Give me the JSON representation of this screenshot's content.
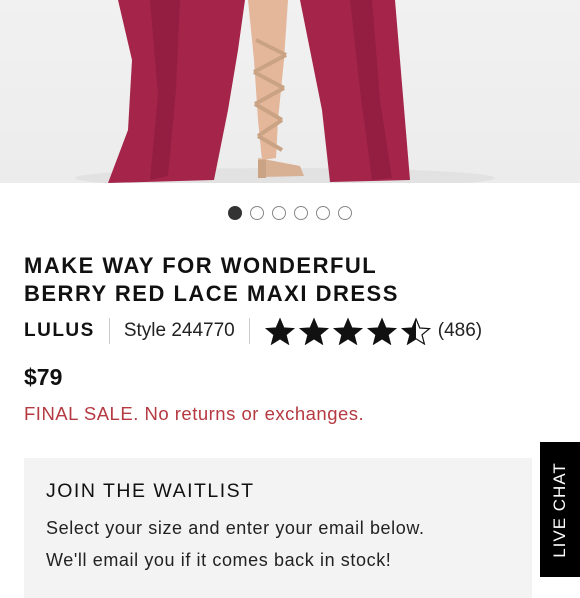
{
  "product": {
    "title_line1": "MAKE WAY FOR WONDERFUL",
    "title_line2": "BERRY RED LACE MAXI DRESS",
    "brand": "LULUS",
    "style": "Style 244770",
    "rating": 4.5,
    "rating_max": 5,
    "review_count": "(486)",
    "price": "$79",
    "sale_notice": "FINAL SALE. No returns or exchanges."
  },
  "carousel": {
    "total": 6,
    "active_index": 0
  },
  "waitlist": {
    "title": "JOIN THE WAITLIST",
    "line1": "Select your size and enter your email below.",
    "line2": "We'll email you if it comes back in stock!"
  },
  "live_chat": {
    "label": "LIVE CHAT"
  },
  "colors": {
    "sale_red": "#b53a42",
    "dress_berry": "#a5244a",
    "waitlist_bg": "#f3f3f3"
  },
  "icons": {
    "rating": "star-icon",
    "carousel_indicator": "dot-icon"
  }
}
